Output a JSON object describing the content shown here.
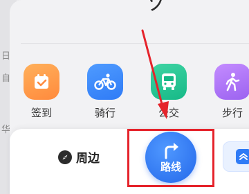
{
  "background": {
    "left_chars": [
      "日",
      "自",
      "华"
    ]
  },
  "header": {
    "partial_glyph": "ソ"
  },
  "shortcuts": [
    {
      "label": "签到",
      "icon": "calendar-check-icon",
      "color": "#ff8a3d"
    },
    {
      "label": "骑行",
      "icon": "bicycle-icon",
      "color": "#2f7bf6"
    },
    {
      "label": "公交",
      "icon": "bus-icon",
      "color": "#16b987"
    },
    {
      "label": "步行",
      "icon": "walking-icon",
      "color": "#9b62f0"
    }
  ],
  "bottom_bar": {
    "nearby_label": "周边",
    "route_label": "路线",
    "more_icon": "chevron-up-icon"
  },
  "annotation": {
    "highlight_color": "#e5232b"
  }
}
